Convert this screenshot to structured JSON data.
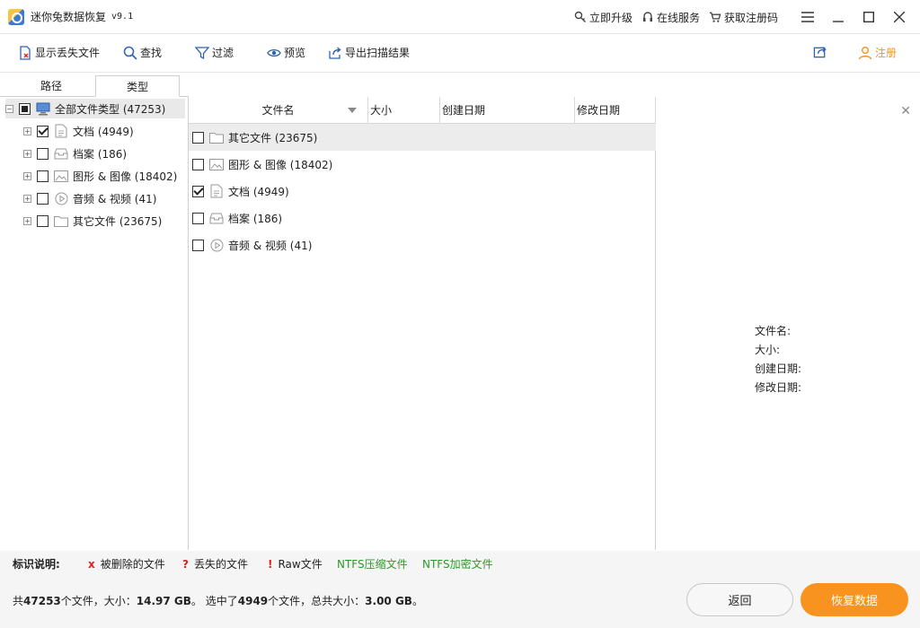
{
  "titlebar": {
    "app_title": "迷你兔数据恢复",
    "version": "v9.1",
    "upgrade_label": "立即升级",
    "service_label": "在线服务",
    "register_code_label": "获取注册码"
  },
  "toolbar": {
    "show_lost_label": "显示丢失文件",
    "find_label": "查找",
    "filter_label": "过滤",
    "preview_label": "预览",
    "export_label": "导出扫描结果",
    "register_label": "注册"
  },
  "tabs": {
    "path_label": "路径",
    "type_label": "类型"
  },
  "tree": {
    "root": "全部文件类型 (47253)",
    "items": [
      {
        "label": "文档 (4949)",
        "checked": true
      },
      {
        "label": "档案 (186)",
        "checked": false
      },
      {
        "label": "图形 & 图像 (18402)",
        "checked": false
      },
      {
        "label": "音频 & 视频 (41)",
        "checked": false
      },
      {
        "label": "其它文件 (23675)",
        "checked": false
      }
    ]
  },
  "list": {
    "columns": [
      "文件名",
      "大小",
      "创建日期",
      "修改日期"
    ],
    "rows": [
      {
        "label": "其它文件 (23675)",
        "checked": false
      },
      {
        "label": "图形 & 图像 (18402)",
        "checked": false
      },
      {
        "label": "文档 (4949)",
        "checked": true
      },
      {
        "label": "档案 (186)",
        "checked": false
      },
      {
        "label": "音频 & 视频 (41)",
        "checked": false
      }
    ]
  },
  "preview": {
    "filename_label": "文件名:",
    "size_label": "大小:",
    "created_label": "创建日期:",
    "modified_label": "修改日期:"
  },
  "legend": {
    "title": "标识说明:",
    "deleted_mark": "x",
    "deleted_label": "被删除的文件",
    "lost_mark": "?",
    "lost_label": "丢失的文件",
    "raw_mark": "!",
    "raw_label": "Raw文件",
    "ntfs_compressed_label": "NTFS压缩文件",
    "ntfs_encrypted_label": "NTFS加密文件"
  },
  "status": {
    "prefix": "共",
    "total_files": "47253",
    "mid1": "个文件，大小：",
    "total_size": "14.97 GB",
    "mid2": "。 选中了",
    "selected_files": "4949",
    "mid3": "个文件，总共大小：",
    "selected_size": "3.00 GB",
    "suffix": "。"
  },
  "buttons": {
    "back_label": "返回",
    "recover_label": "恢复数据"
  },
  "colors": {
    "accent": "#f7931e",
    "ntfs_green": "#2a9a2a",
    "mark_red": "#e02020"
  }
}
